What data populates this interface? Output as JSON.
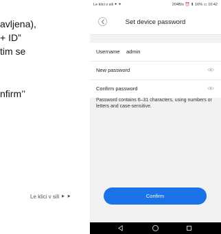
{
  "document": {
    "lines": [
      "avljena),",
      "+ ID”",
      "tim se",
      "nfirm’’"
    ],
    "footer": "Le klici v sili ⯈ ⯈"
  },
  "status_bar": {
    "left_text": "Le klici v sili ⯈ ⯈",
    "right_text": "204B/s ⏰ ⬆ 16% ▭ 10:42"
  },
  "header": {
    "title": "Set device password"
  },
  "form": {
    "username_label": "Username",
    "username_value": "admin",
    "new_password_placeholder": "New password",
    "confirm_password_placeholder": "Confirm password"
  },
  "hint": "Password contains 6–31 characters, using numbers or letters and case-sensitive.",
  "confirm_button": "Confirm",
  "icons": {
    "back": "chevron-left-icon",
    "eye": "eye-icon",
    "nav_back": "triangle-back-icon",
    "nav_home": "circle-home-icon",
    "nav_recent": "square-recent-icon"
  },
  "colors": {
    "accent": "#1a73e8",
    "page_bg": "#f2f2f2",
    "navbar": "#000000"
  }
}
